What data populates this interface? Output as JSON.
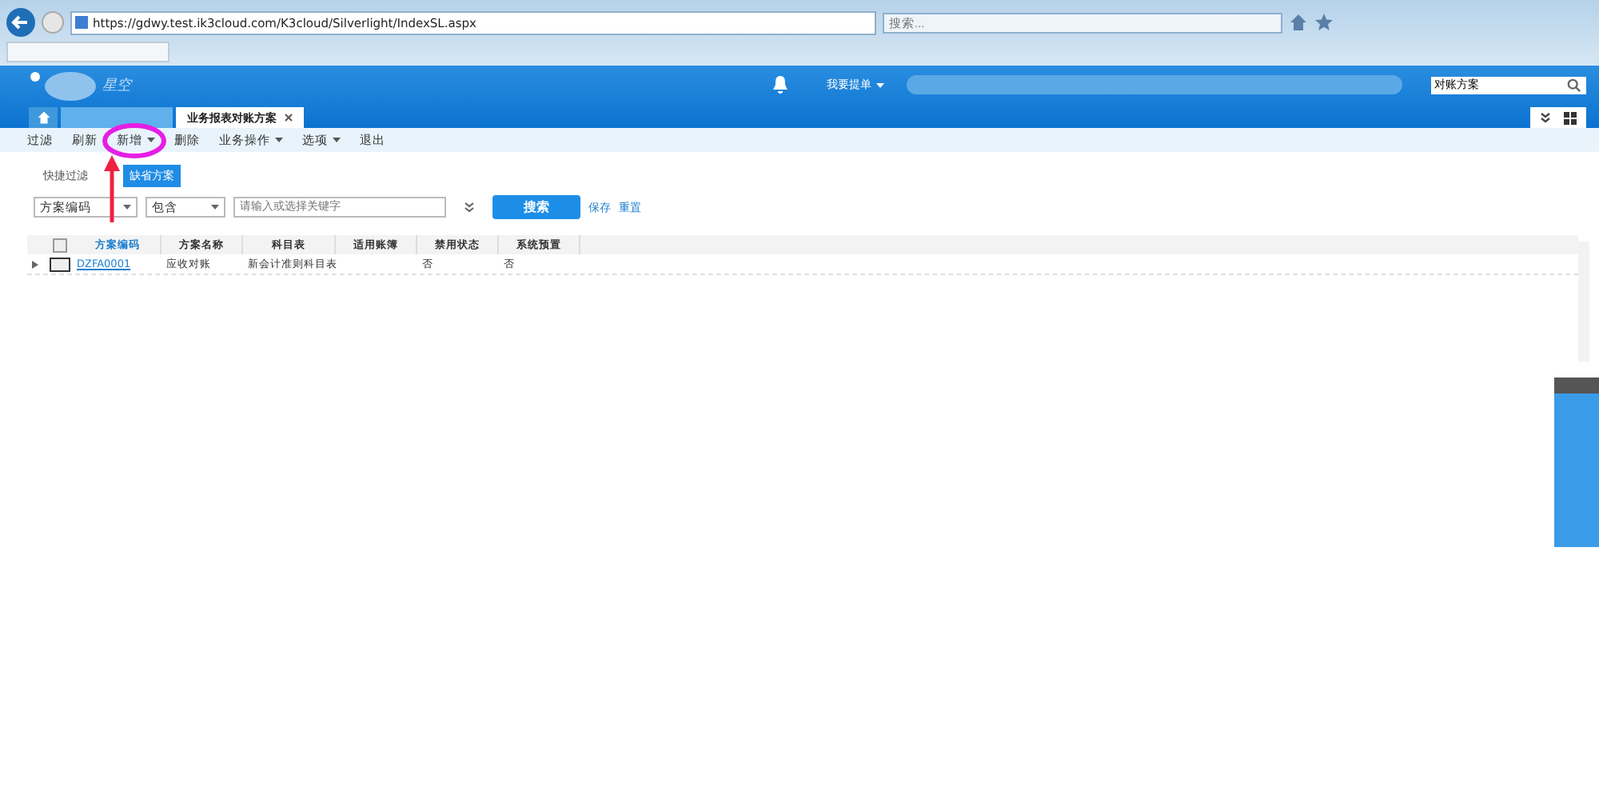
{
  "browser": {
    "url": "https://gdwy.test.ik3cloud.com/K3cloud/Silverlight/IndexSL.aspx",
    "search_placeholder": "搜索..."
  },
  "header": {
    "logo_text": "星空",
    "menu": "我要提单",
    "search_value": "对账方案"
  },
  "tabs": [
    {
      "kind": "home",
      "selected": false
    },
    {
      "kind": "blurred",
      "selected": false
    },
    {
      "kind": "text",
      "label": "业务报表对账方案",
      "selected": true
    }
  ],
  "toolbar": [
    {
      "label": "过滤",
      "dropdown": false
    },
    {
      "label": "刷新",
      "dropdown": false
    },
    {
      "label": "新增",
      "dropdown": true
    },
    {
      "label": "删除",
      "dropdown": false
    },
    {
      "label": "业务操作",
      "dropdown": true
    },
    {
      "label": "选项",
      "dropdown": true
    },
    {
      "label": "退出",
      "dropdown": false
    }
  ],
  "quick_filter": {
    "label": "快捷过滤",
    "schemes": [
      {
        "label": "缺省方案",
        "selected": true
      }
    ]
  },
  "filter": {
    "field": "方案编码",
    "operator": "包含",
    "placeholder": "请输入或选择关键字",
    "search": "搜索",
    "save": "保存",
    "reset": "重置"
  },
  "table": {
    "all_checked": false,
    "columns": [
      "方案编码",
      "方案名称",
      "科目表",
      "适用账簿",
      "禁用状态",
      "系统预置"
    ],
    "rows": [
      {
        "checked": false,
        "cells": [
          "DZFA0001",
          "应收对账",
          "新会计准则科目表",
          "",
          "否",
          "否"
        ]
      }
    ]
  }
}
